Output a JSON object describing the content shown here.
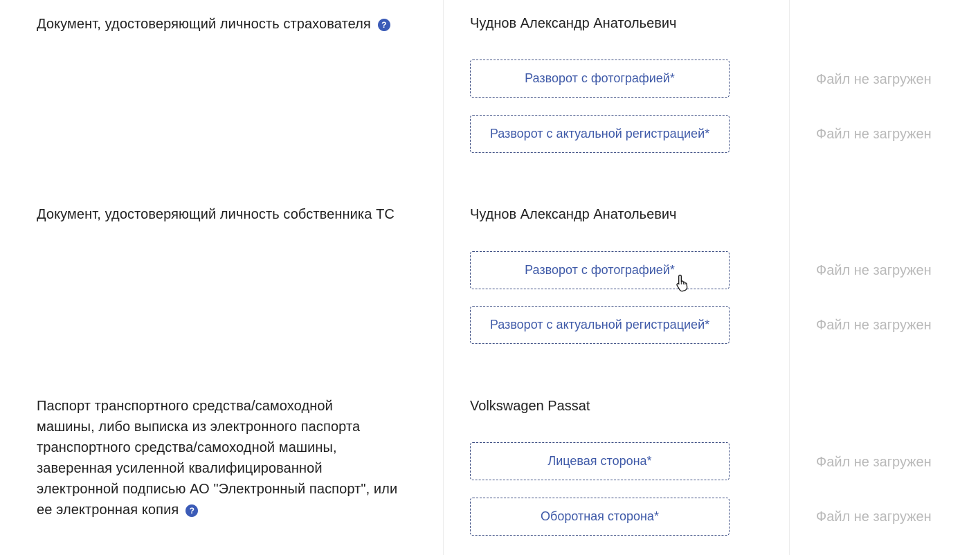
{
  "help_glyph": "?",
  "rows": [
    {
      "title": "Документ, удостоверяющий личность страхователя",
      "has_help": true,
      "name": "Чуднов Александр Анатольевич",
      "uploads": [
        {
          "label": "Разворот с фотографией*",
          "status": "Файл не загружен"
        },
        {
          "label": "Разворот с актуальной регистрацией*",
          "status": "Файл не загружен"
        }
      ]
    },
    {
      "title": "Документ, удостоверяющий личность собственника ТС",
      "has_help": false,
      "name": "Чуднов Александр Анатольевич",
      "uploads": [
        {
          "label": "Разворот с фотографией*",
          "status": "Файл не загружен"
        },
        {
          "label": "Разворот с актуальной регистрацией*",
          "status": "Файл не загружен"
        }
      ]
    },
    {
      "title_lines": [
        "Паспорт транспортного средства/самоходной",
        "машины, либо выписка из электронного паспорта",
        "транспортного средства/самоходной машины,",
        "заверенная усиленной квалифицированной",
        "электронной подписью АО \"Электронный паспорт\", или",
        "ее электронная копия"
      ],
      "has_help": true,
      "name": "Volkswagen Passat",
      "uploads": [
        {
          "label": "Лицевая сторона*",
          "status": "Файл не загружен"
        },
        {
          "label": "Оборотная сторона*",
          "status": "Файл не загружен"
        }
      ]
    }
  ],
  "colors": {
    "accent": "#3f5aa8",
    "help_icon": "#3b5bb7",
    "status_text": "#b9b9b9",
    "dashed_border": "#3e4f84"
  },
  "icons": {
    "help": "help-icon",
    "cursor": "hand-pointer-icon"
  }
}
